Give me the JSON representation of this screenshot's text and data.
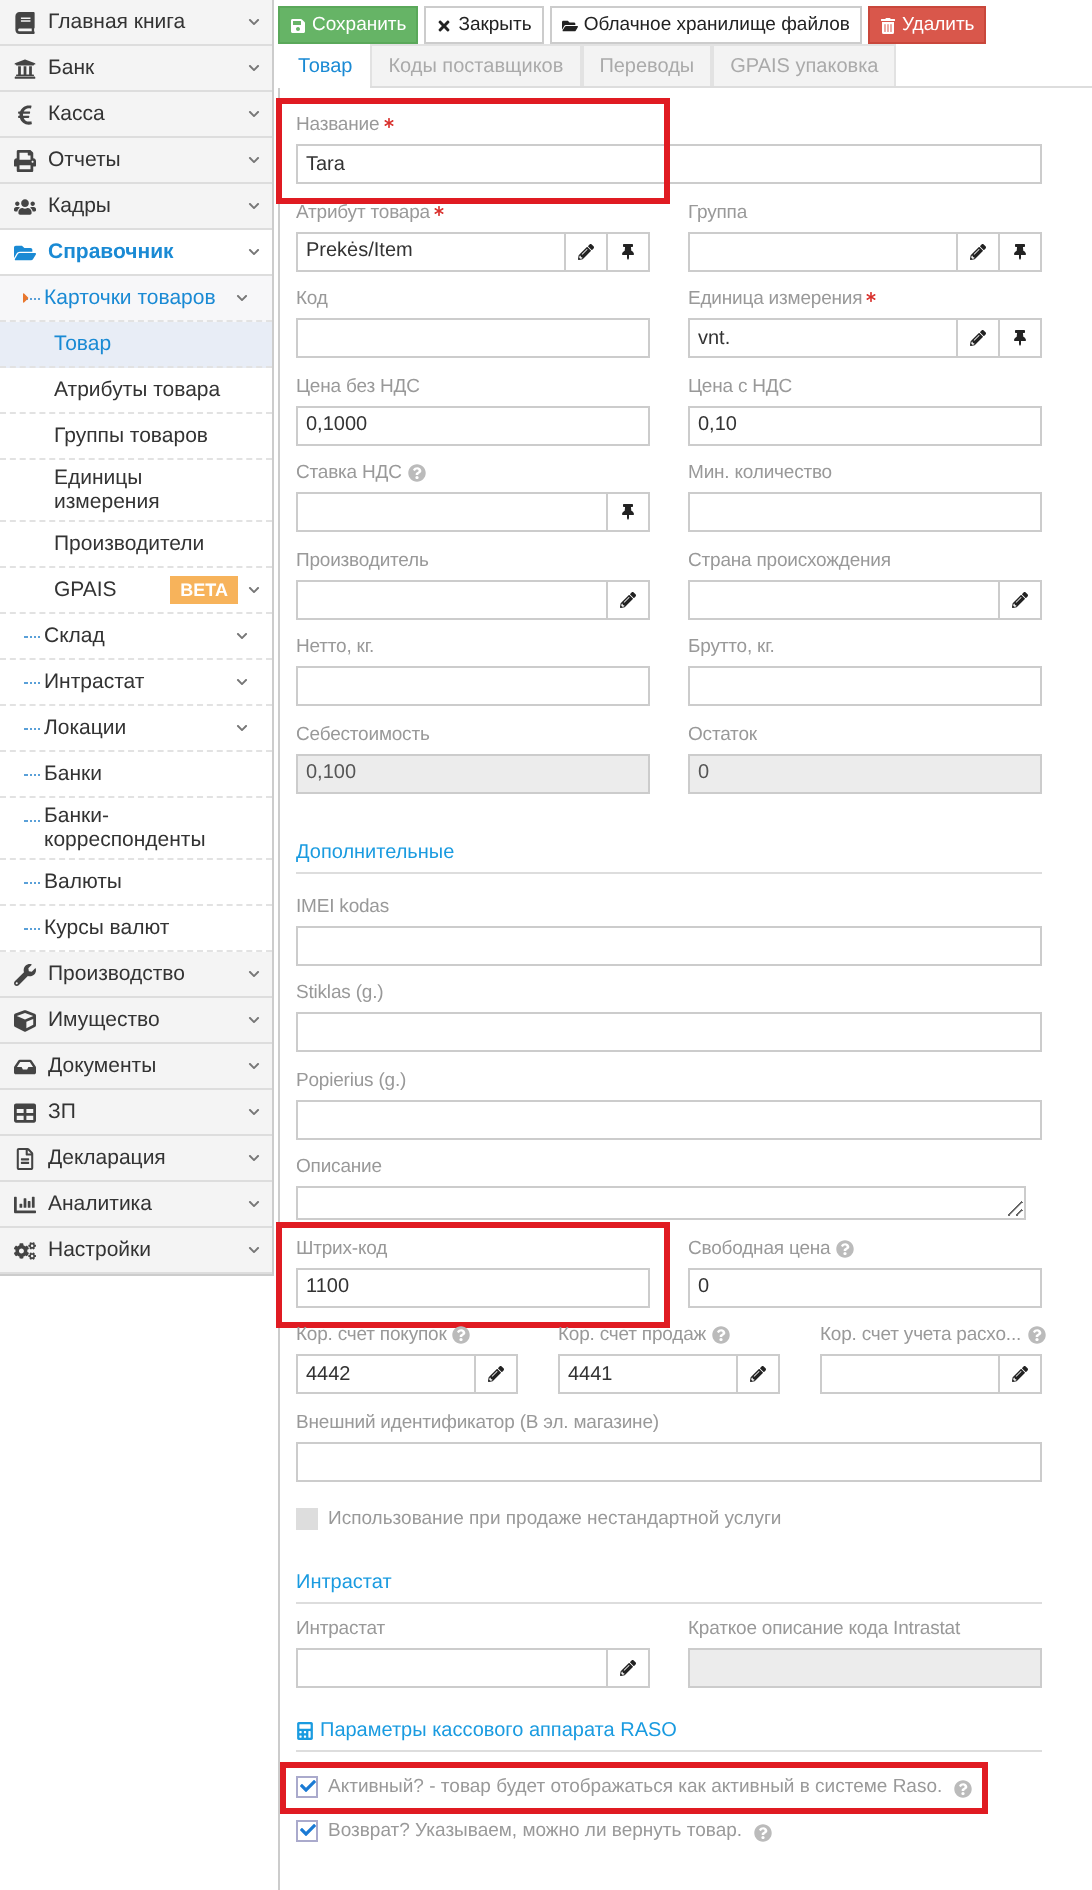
{
  "sidebar": {
    "items": [
      {
        "label": "Главная книга",
        "expandable": true,
        "expanded": false,
        "selected": false
      },
      {
        "label": "Банк",
        "expandable": true,
        "expanded": false,
        "selected": false
      },
      {
        "label": "Касса",
        "expandable": true,
        "expanded": false,
        "selected": false
      },
      {
        "label": "Отчеты",
        "expandable": true,
        "expanded": false,
        "selected": false
      },
      {
        "label": "Кадры",
        "expandable": true,
        "expanded": false,
        "selected": false
      },
      {
        "label": "Справочник",
        "expandable": true,
        "expanded": true,
        "selected": false,
        "children": [
          {
            "label": "Карточки товаров",
            "expandable": true,
            "expanded": true,
            "selected": false,
            "children": [
              {
                "label": "Товар",
                "expandable": false,
                "expanded": false,
                "selected": true
              },
              {
                "label": "Атрибуты товара",
                "expandable": false,
                "expanded": false,
                "selected": false
              },
              {
                "label": "Группы товаров",
                "expandable": false,
                "expanded": false,
                "selected": false
              },
              {
                "label": "Единицы измерения",
                "expandable": false,
                "expanded": false,
                "selected": false
              },
              {
                "label": "Производители",
                "expandable": false,
                "expanded": false,
                "selected": false
              },
              {
                "label": "GPAIS",
                "badge": "BETA",
                "expandable": true,
                "expanded": false,
                "selected": false
              }
            ]
          },
          {
            "label": "Склад",
            "expandable": true,
            "expanded": false,
            "selected": false
          },
          {
            "label": "Интрастат",
            "expandable": true,
            "expanded": false,
            "selected": false
          },
          {
            "label": "Локации",
            "expandable": true,
            "expanded": false,
            "selected": false
          },
          {
            "label": "Банки",
            "expandable": false,
            "expanded": false,
            "selected": false
          },
          {
            "label": "Банки-корреспонденты",
            "expandable": false,
            "expanded": false,
            "selected": false
          },
          {
            "label": "Валюты",
            "expandable": false,
            "expanded": false,
            "selected": false
          },
          {
            "label": "Курсы валют",
            "expandable": false,
            "expanded": false,
            "selected": false
          }
        ]
      },
      {
        "label": "Производство",
        "expandable": true,
        "expanded": false,
        "selected": false
      },
      {
        "label": "Имущество",
        "expandable": true,
        "expanded": false,
        "selected": false
      },
      {
        "label": "Документы",
        "expandable": true,
        "expanded": false,
        "selected": false
      },
      {
        "label": "ЗП",
        "expandable": true,
        "expanded": false,
        "selected": false
      },
      {
        "label": "Декларация",
        "expandable": true,
        "expanded": false,
        "selected": false
      },
      {
        "label": "Аналитика",
        "expandable": true,
        "expanded": false,
        "selected": false
      },
      {
        "label": "Настройки",
        "expandable": true,
        "expanded": false,
        "selected": false
      }
    ]
  },
  "toolbar": [
    {
      "label": "Сохранить",
      "kind": "save"
    },
    {
      "label": "Закрыть",
      "kind": "close"
    },
    {
      "label": "Облачное хранилище файлов",
      "kind": "cloud"
    },
    {
      "label": "Удалить",
      "kind": "delete"
    }
  ],
  "tabs": [
    {
      "label": "Товар",
      "selected": true
    },
    {
      "label": "Коды поставщиков",
      "selected": false
    },
    {
      "label": "Переводы",
      "selected": false
    },
    {
      "label": "GPAIS упаковка",
      "selected": false
    }
  ],
  "form": [
    {
      "kind": "row",
      "fields": [
        {
          "label": "Название",
          "kind": "text",
          "value": "Tara",
          "required": true,
          "help": false,
          "readonly": false,
          "highlighted": true,
          "edit": false,
          "pin": false
        }
      ]
    },
    {
      "kind": "row",
      "fields": [
        {
          "label": "Атрибут товара",
          "kind": "text",
          "value": "Prekės/Item",
          "required": true,
          "help": false,
          "readonly": false,
          "highlighted": false,
          "edit": true,
          "pin": true
        },
        {
          "label": "Группа",
          "kind": "text",
          "required": false,
          "help": false,
          "readonly": false,
          "highlighted": false,
          "edit": true,
          "pin": true
        }
      ]
    },
    {
      "kind": "row",
      "fields": [
        {
          "label": "Код",
          "kind": "text",
          "required": false,
          "help": false,
          "readonly": false,
          "highlighted": false,
          "edit": false,
          "pin": false
        },
        {
          "label": "Единица измерения",
          "kind": "text",
          "value": "vnt.",
          "required": true,
          "help": false,
          "readonly": false,
          "highlighted": false,
          "edit": true,
          "pin": true
        }
      ]
    },
    {
      "kind": "row",
      "fields": [
        {
          "label": "Цена без НДС",
          "kind": "text",
          "value": "0,1000",
          "required": false,
          "help": false,
          "readonly": false,
          "highlighted": false,
          "edit": false,
          "pin": false
        },
        {
          "label": "Цена с НДС",
          "kind": "text",
          "value": "0,10",
          "required": false,
          "help": false,
          "readonly": false,
          "highlighted": false,
          "edit": false,
          "pin": false
        }
      ]
    },
    {
      "kind": "row",
      "fields": [
        {
          "label": "Ставка НДС",
          "kind": "text",
          "required": false,
          "help": true,
          "readonly": false,
          "highlighted": false,
          "edit": false,
          "pin": true
        },
        {
          "label": "Мин. количество",
          "kind": "text",
          "required": false,
          "help": false,
          "readonly": false,
          "highlighted": false,
          "edit": false,
          "pin": false
        }
      ]
    },
    {
      "kind": "row",
      "fields": [
        {
          "label": "Производитель",
          "kind": "text",
          "required": false,
          "help": false,
          "readonly": false,
          "highlighted": false,
          "edit": true,
          "pin": false
        },
        {
          "label": "Страна происхождения",
          "kind": "text",
          "required": false,
          "help": false,
          "readonly": false,
          "highlighted": false,
          "edit": true,
          "pin": false
        }
      ]
    },
    {
      "kind": "row",
      "fields": [
        {
          "label": "Нетто, кг.",
          "kind": "text",
          "required": false,
          "help": false,
          "readonly": false,
          "highlighted": false,
          "edit": false,
          "pin": false
        },
        {
          "label": "Брутто, кг.",
          "kind": "text",
          "required": false,
          "help": false,
          "readonly": false,
          "highlighted": false,
          "edit": false,
          "pin": false
        }
      ]
    },
    {
      "kind": "row",
      "fields": [
        {
          "label": "Себестоимость",
          "kind": "text",
          "value": "0,100",
          "required": false,
          "help": false,
          "readonly": true,
          "highlighted": false,
          "edit": false,
          "pin": false
        },
        {
          "label": "Остаток",
          "kind": "text",
          "value": "0",
          "required": false,
          "help": false,
          "readonly": true,
          "highlighted": false,
          "edit": false,
          "pin": false
        }
      ]
    },
    {
      "kind": "heading",
      "label": "Дополнительные",
      "icon": false
    },
    {
      "kind": "row",
      "fields": [
        {
          "label": "IMEI kodas",
          "kind": "text",
          "required": false,
          "help": false,
          "readonly": false,
          "highlighted": false,
          "edit": false,
          "pin": false
        }
      ]
    },
    {
      "kind": "row",
      "fields": [
        {
          "label": "Stiklas (g.)",
          "kind": "text",
          "required": false,
          "help": false,
          "readonly": false,
          "highlighted": false,
          "edit": false,
          "pin": false
        }
      ]
    },
    {
      "kind": "row",
      "fields": [
        {
          "label": "Popierius (g.)",
          "kind": "text",
          "required": false,
          "help": false,
          "readonly": false,
          "highlighted": false,
          "edit": false,
          "pin": false
        }
      ]
    },
    {
      "kind": "row",
      "fields": [
        {
          "label": "Описание",
          "kind": "textarea",
          "required": false,
          "help": false,
          "readonly": false,
          "highlighted": false,
          "edit": false,
          "pin": false
        }
      ]
    },
    {
      "kind": "row",
      "fields": [
        {
          "label": "Штрих-код",
          "kind": "text",
          "value": "1100",
          "required": false,
          "help": false,
          "readonly": false,
          "highlighted": true,
          "edit": false,
          "pin": false
        },
        {
          "label": "Свободная цена",
          "kind": "text",
          "value": "0",
          "required": false,
          "help": true,
          "readonly": false,
          "highlighted": false,
          "edit": false,
          "pin": false
        }
      ]
    },
    {
      "kind": "row",
      "fields": [
        {
          "label": "Кор. счет покупок",
          "kind": "text",
          "value": "4442",
          "required": false,
          "help": true,
          "readonly": false,
          "highlighted": false,
          "edit": true,
          "pin": false
        },
        {
          "label": "Кор. счет продаж",
          "kind": "text",
          "value": "4441",
          "required": false,
          "help": true,
          "readonly": false,
          "highlighted": false,
          "edit": true,
          "pin": false
        },
        {
          "label": "Кор. счет учета расхо...",
          "kind": "text",
          "required": false,
          "help": true,
          "readonly": false,
          "highlighted": false,
          "edit": true,
          "pin": false
        }
      ]
    },
    {
      "kind": "row",
      "fields": [
        {
          "label": "Внешний идентификатор (В эл. магазине)",
          "kind": "text",
          "required": false,
          "help": false,
          "readonly": false,
          "highlighted": false,
          "edit": false,
          "pin": false
        }
      ]
    },
    {
      "kind": "checkbox",
      "label": "Использование при продаже нестандартной услуги",
      "checked": false,
      "disabled": true,
      "help": false,
      "highlighted": false
    },
    {
      "kind": "heading",
      "label": "Интрастат",
      "icon": false
    },
    {
      "kind": "row",
      "fields": [
        {
          "label": "Интрастат",
          "kind": "text",
          "required": false,
          "help": false,
          "readonly": false,
          "highlighted": false,
          "edit": true,
          "pin": false
        },
        {
          "label": "Краткое описание кода Intrastat",
          "kind": "text",
          "required": false,
          "help": false,
          "readonly": true,
          "highlighted": false,
          "edit": false,
          "pin": false
        }
      ]
    },
    {
      "kind": "heading",
      "label": "Параметры кассового аппарата RASO",
      "icon": true
    },
    {
      "kind": "checkbox",
      "label": "Активный? - товар будет отображаться как активный в системе Raso.",
      "checked": true,
      "disabled": false,
      "help": true,
      "highlighted": true
    },
    {
      "kind": "checkbox",
      "label": "Возврат? Указываем, можно ли вернуть товар.",
      "checked": true,
      "disabled": false,
      "help": true,
      "highlighted": false
    }
  ]
}
